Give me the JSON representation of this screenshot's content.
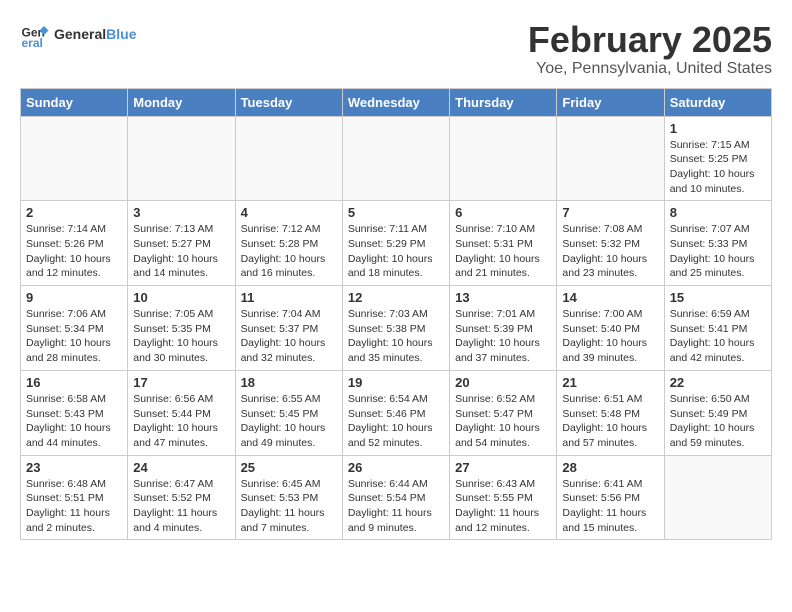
{
  "header": {
    "logo_text_general": "General",
    "logo_text_blue": "Blue",
    "month_title": "February 2025",
    "location": "Yoe, Pennsylvania, United States"
  },
  "weekdays": [
    "Sunday",
    "Monday",
    "Tuesday",
    "Wednesday",
    "Thursday",
    "Friday",
    "Saturday"
  ],
  "weeks": [
    [
      {
        "day": "",
        "info": ""
      },
      {
        "day": "",
        "info": ""
      },
      {
        "day": "",
        "info": ""
      },
      {
        "day": "",
        "info": ""
      },
      {
        "day": "",
        "info": ""
      },
      {
        "day": "",
        "info": ""
      },
      {
        "day": "1",
        "info": "Sunrise: 7:15 AM\nSunset: 5:25 PM\nDaylight: 10 hours and 10 minutes."
      }
    ],
    [
      {
        "day": "2",
        "info": "Sunrise: 7:14 AM\nSunset: 5:26 PM\nDaylight: 10 hours and 12 minutes."
      },
      {
        "day": "3",
        "info": "Sunrise: 7:13 AM\nSunset: 5:27 PM\nDaylight: 10 hours and 14 minutes."
      },
      {
        "day": "4",
        "info": "Sunrise: 7:12 AM\nSunset: 5:28 PM\nDaylight: 10 hours and 16 minutes."
      },
      {
        "day": "5",
        "info": "Sunrise: 7:11 AM\nSunset: 5:29 PM\nDaylight: 10 hours and 18 minutes."
      },
      {
        "day": "6",
        "info": "Sunrise: 7:10 AM\nSunset: 5:31 PM\nDaylight: 10 hours and 21 minutes."
      },
      {
        "day": "7",
        "info": "Sunrise: 7:08 AM\nSunset: 5:32 PM\nDaylight: 10 hours and 23 minutes."
      },
      {
        "day": "8",
        "info": "Sunrise: 7:07 AM\nSunset: 5:33 PM\nDaylight: 10 hours and 25 minutes."
      }
    ],
    [
      {
        "day": "9",
        "info": "Sunrise: 7:06 AM\nSunset: 5:34 PM\nDaylight: 10 hours and 28 minutes."
      },
      {
        "day": "10",
        "info": "Sunrise: 7:05 AM\nSunset: 5:35 PM\nDaylight: 10 hours and 30 minutes."
      },
      {
        "day": "11",
        "info": "Sunrise: 7:04 AM\nSunset: 5:37 PM\nDaylight: 10 hours and 32 minutes."
      },
      {
        "day": "12",
        "info": "Sunrise: 7:03 AM\nSunset: 5:38 PM\nDaylight: 10 hours and 35 minutes."
      },
      {
        "day": "13",
        "info": "Sunrise: 7:01 AM\nSunset: 5:39 PM\nDaylight: 10 hours and 37 minutes."
      },
      {
        "day": "14",
        "info": "Sunrise: 7:00 AM\nSunset: 5:40 PM\nDaylight: 10 hours and 39 minutes."
      },
      {
        "day": "15",
        "info": "Sunrise: 6:59 AM\nSunset: 5:41 PM\nDaylight: 10 hours and 42 minutes."
      }
    ],
    [
      {
        "day": "16",
        "info": "Sunrise: 6:58 AM\nSunset: 5:43 PM\nDaylight: 10 hours and 44 minutes."
      },
      {
        "day": "17",
        "info": "Sunrise: 6:56 AM\nSunset: 5:44 PM\nDaylight: 10 hours and 47 minutes."
      },
      {
        "day": "18",
        "info": "Sunrise: 6:55 AM\nSunset: 5:45 PM\nDaylight: 10 hours and 49 minutes."
      },
      {
        "day": "19",
        "info": "Sunrise: 6:54 AM\nSunset: 5:46 PM\nDaylight: 10 hours and 52 minutes."
      },
      {
        "day": "20",
        "info": "Sunrise: 6:52 AM\nSunset: 5:47 PM\nDaylight: 10 hours and 54 minutes."
      },
      {
        "day": "21",
        "info": "Sunrise: 6:51 AM\nSunset: 5:48 PM\nDaylight: 10 hours and 57 minutes."
      },
      {
        "day": "22",
        "info": "Sunrise: 6:50 AM\nSunset: 5:49 PM\nDaylight: 10 hours and 59 minutes."
      }
    ],
    [
      {
        "day": "23",
        "info": "Sunrise: 6:48 AM\nSunset: 5:51 PM\nDaylight: 11 hours and 2 minutes."
      },
      {
        "day": "24",
        "info": "Sunrise: 6:47 AM\nSunset: 5:52 PM\nDaylight: 11 hours and 4 minutes."
      },
      {
        "day": "25",
        "info": "Sunrise: 6:45 AM\nSunset: 5:53 PM\nDaylight: 11 hours and 7 minutes."
      },
      {
        "day": "26",
        "info": "Sunrise: 6:44 AM\nSunset: 5:54 PM\nDaylight: 11 hours and 9 minutes."
      },
      {
        "day": "27",
        "info": "Sunrise: 6:43 AM\nSunset: 5:55 PM\nDaylight: 11 hours and 12 minutes."
      },
      {
        "day": "28",
        "info": "Sunrise: 6:41 AM\nSunset: 5:56 PM\nDaylight: 11 hours and 15 minutes."
      },
      {
        "day": "",
        "info": ""
      }
    ]
  ]
}
